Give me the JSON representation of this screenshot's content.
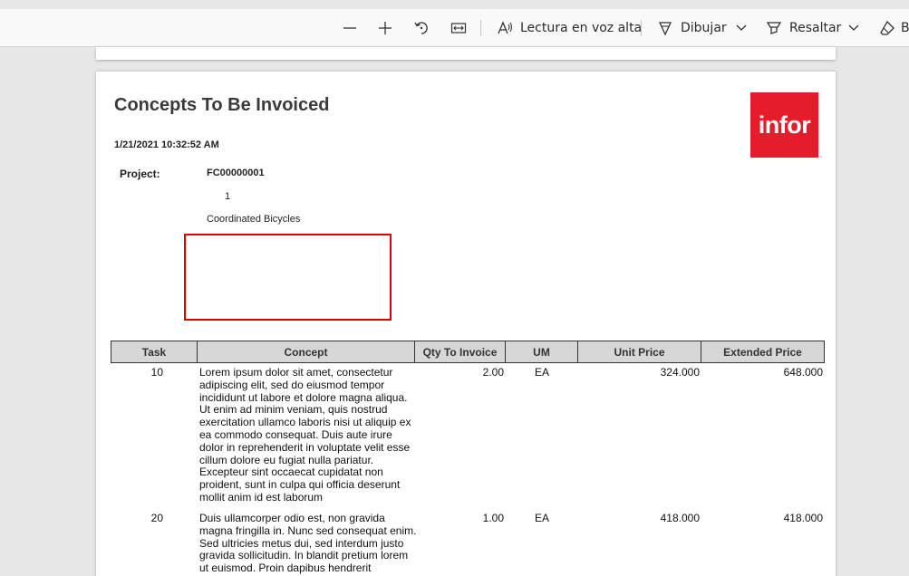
{
  "toolbar": {
    "read_aloud_label": "Lectura en voz alta",
    "draw_label": "Dibujar",
    "highlight_label": "Resaltar",
    "erase_label": "B"
  },
  "document": {
    "title": "Concepts To Be Invoiced",
    "datetime": "1/21/2021 10:32:52 AM",
    "project_label": "Project:",
    "project_code": "FC00000001",
    "project_number": "1",
    "project_name": "Coordinated Bicycles",
    "logo_text": "infor",
    "logo_tm": "™",
    "table": {
      "headers": {
        "task": "Task",
        "concept": "Concept",
        "qty": "Qty To Invoice",
        "um": "UM",
        "unit_price": "Unit Price",
        "extended_price": "Extended Price"
      },
      "rows": [
        {
          "task": "10",
          "concept": "Lorem ipsum dolor sit amet, consectetur adipiscing elit, sed do eiusmod tempor incididunt ut labore et dolore magna aliqua. Ut enim ad minim veniam, quis nostrud exercitation ullamco laboris nisi ut aliquip ex ea commodo consequat. Duis aute irure dolor in reprehenderit in voluptate velit esse cillum dolore eu fugiat nulla pariatur. Excepteur sint occaecat cupidatat non proident, sunt in culpa qui officia deserunt mollit anim id est laborum",
          "qty": "2.00",
          "um": "EA",
          "unit_price": "324.000",
          "extended_price": "648.000"
        },
        {
          "task": "20",
          "concept": "Duis ullamcorper odio est, non gravida magna fringilla in. Nunc sed consequat enim. Sed ultricies metus dui, sed interdum justo gravida sollicitudin. In blandit pretium lorem ut euismod. Proin dapibus hendrerit",
          "qty": "1.00",
          "um": "EA",
          "unit_price": "418.000",
          "extended_price": "418.000"
        }
      ]
    }
  }
}
